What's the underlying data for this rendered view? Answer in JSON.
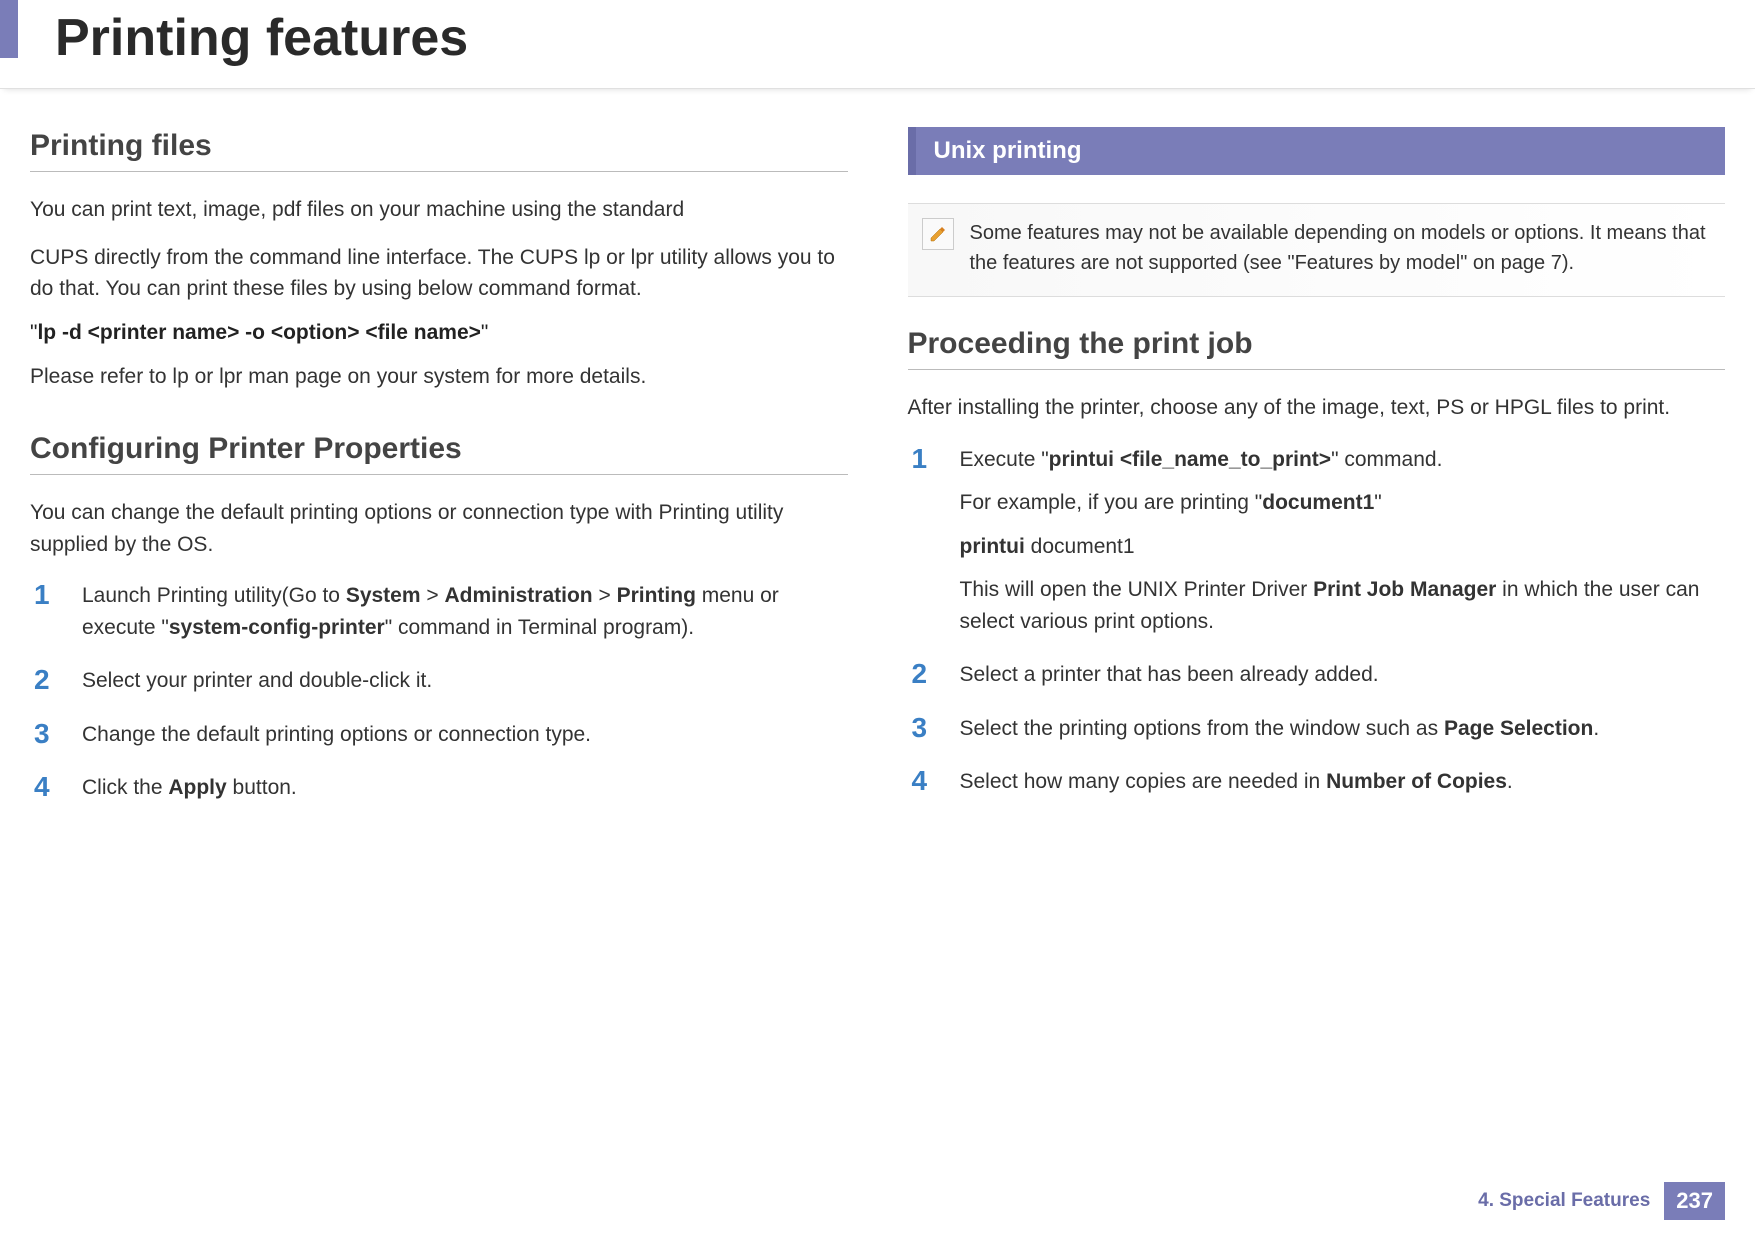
{
  "header": {
    "title": "Printing features"
  },
  "left": {
    "sec1": {
      "title": "Printing files",
      "p1": "You can print text, image, pdf files on your machine using the standard",
      "p2": "CUPS directly from the command line interface. The CUPS lp or lpr utility allows you to do that. You can print these files by using below command format.",
      "cmd_open": "\"",
      "cmd_bold": "lp -d <printer name> -o <option> <file name>",
      "cmd_close": "\"",
      "p3": "Please refer to lp or lpr man page on your system for more details."
    },
    "sec2": {
      "title": "Configuring Printer Properties",
      "p1": "You can change the default printing options or connection type with Printing utility supplied by the OS.",
      "steps": {
        "s1": {
          "pre": "Launch Printing utility(Go to ",
          "b1": "System",
          "sep1": " > ",
          "b2": "Administration",
          "sep2": " > ",
          "b3": "Printing",
          "mid": " menu or execute \"",
          "b4": "system-config-printer",
          "post": "\" command in Terminal program)."
        },
        "s2": "Select your printer and double-click it.",
        "s3": "Change the default printing options or connection type.",
        "s4_pre": "Click the ",
        "s4_b": "Apply",
        "s4_post": " button."
      }
    }
  },
  "right": {
    "sectionHeader": "Unix printing",
    "note": "Some features may not be available depending on models or options. It means that the features are not supported (see \"Features by model\" on page 7).",
    "sec1": {
      "title": "Proceeding the print job",
      "p1": "After installing the printer, choose any of the image, text, PS or HPGL files to print.",
      "steps": {
        "s1": {
          "l1_pre": "Execute \"",
          "l1_b": "printui <file_name_to_print>",
          "l1_post": "\" command.",
          "l2_pre": "For example, if you are printing \"",
          "l2_b": "document1",
          "l2_post": "\"",
          "l3_b": "printui",
          "l3_post": " document1",
          "l4_pre": "This will open the UNIX Printer Driver ",
          "l4_b": "Print Job Manager",
          "l4_post": " in which the user can select various print options."
        },
        "s2": "Select a printer that has been already added.",
        "s3_pre": "Select the printing options from the window such as ",
        "s3_b": "Page Selection",
        "s3_post": ".",
        "s4_pre": "Select how many copies are needed in ",
        "s4_b": "Number of Copies",
        "s4_post": "."
      }
    }
  },
  "nums": {
    "n1": "1",
    "n2": "2",
    "n3": "3",
    "n4": "4"
  },
  "footer": {
    "chapter": "4.  Special Features",
    "page": "237"
  }
}
